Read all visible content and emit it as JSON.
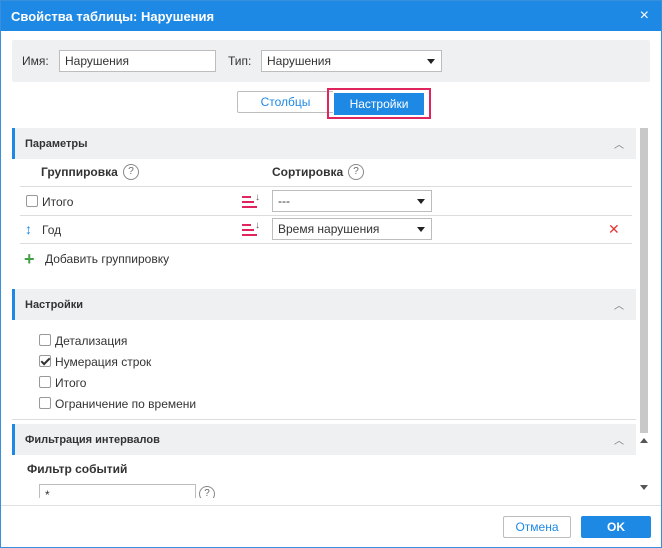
{
  "window": {
    "title": "Свойства таблицы: Нарушения",
    "close_glyph": "×"
  },
  "header": {
    "name_label": "Имя:",
    "name_value": "Нарушения",
    "type_label": "Тип:",
    "type_value": "Нарушения"
  },
  "tabs": [
    {
      "label": "Столбцы",
      "active": false
    },
    {
      "label": "Настройки",
      "active": true
    }
  ],
  "params": {
    "title": "Параметры",
    "group_header": "Группировка",
    "sort_header": "Сортировка",
    "help_glyph": "?",
    "rows": [
      {
        "label": "Итого",
        "sort_value": "---"
      },
      {
        "label": "Год",
        "sort_value": "Время нарушения"
      }
    ],
    "add_label": "Добавить группировку"
  },
  "settings": {
    "title": "Настройки",
    "options": [
      {
        "label": "Детализация",
        "checked": false
      },
      {
        "label": "Нумерация строк",
        "checked": true
      },
      {
        "label": "Итого",
        "checked": false
      },
      {
        "label": "Ограничение по времени",
        "checked": false
      }
    ]
  },
  "filter": {
    "title": "Фильтрация интервалов",
    "event_filter_label": "Фильтр событий",
    "event_filter_value": "*"
  },
  "footer": {
    "cancel_label": "Отмена",
    "ok_label": "OK"
  },
  "colors": {
    "accent": "#1e88e5",
    "highlight": "#e0245e",
    "delete": "#e53935",
    "add": "#43a047"
  },
  "icons": {
    "close": "close-icon",
    "collapse": "chevron-up-icon",
    "sort": "sort-icon",
    "move": "drag-updown-icon",
    "delete": "delete-x-icon",
    "add": "plus-icon",
    "help": "help-icon"
  }
}
